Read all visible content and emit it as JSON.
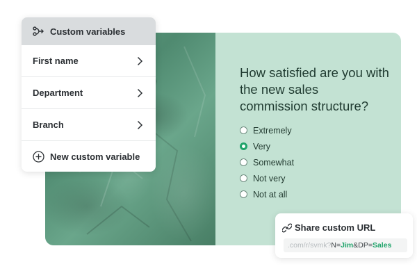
{
  "survey": {
    "question": "How satisfied are you with the new sales commission structure?",
    "options": [
      {
        "label": "Extremely",
        "selected": false
      },
      {
        "label": "Very",
        "selected": true
      },
      {
        "label": "Somewhat",
        "selected": false
      },
      {
        "label": "Not very",
        "selected": false
      },
      {
        "label": "Not at all",
        "selected": false
      }
    ]
  },
  "custom_variables": {
    "header_label": "Custom variables",
    "header_icon": "branch-icon",
    "items": [
      {
        "label": "First name",
        "icon": "chevron-right-icon"
      },
      {
        "label": "Department",
        "icon": "chevron-right-icon"
      },
      {
        "label": "Branch",
        "icon": "chevron-right-icon"
      }
    ],
    "new_label": "New custom variable",
    "new_icon": "plus-circle-icon"
  },
  "share": {
    "title": "Share custom URL",
    "icon": "link-icon",
    "url_prefix": ".com/r/svmk?",
    "url_param1_key": "N=",
    "url_param1_value": "Jim",
    "url_separator": "&DP=",
    "url_param2_value": "Sales"
  },
  "colors": {
    "accent_green": "#1fa36a",
    "card_background": "#c3e2d3",
    "header_gray": "#d9dcde"
  }
}
